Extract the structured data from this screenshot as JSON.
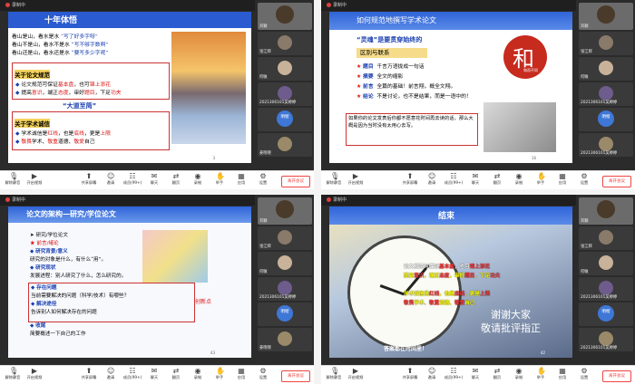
{
  "meeting": {
    "recording": "录制中",
    "leave": "离开会议"
  },
  "toolbar": [
    "解除静音",
    "开启视频",
    "共享屏幕",
    "邀请",
    "成员(99+)",
    "聊天",
    "翻页",
    "录制",
    "举手",
    "应用",
    "设置"
  ],
  "slides": [
    {
      "title": "十年体悟",
      "poem": [
        [
          "看山是山，看水是水",
          "“写了好多字呀”"
        ],
        [
          "看山不是山，看水不是水",
          "“写不够字数啊”"
        ],
        [
          "看山还是山，看水还是水",
          "“要写多少字呢”"
        ]
      ],
      "sec1": "关于论文规范",
      "b1": [
        "论文规范可保证",
        "基本盘",
        "，也可",
        "锦上添花"
      ],
      "b2": [
        "提高",
        "意识",
        "，端正",
        "态度",
        "，审好",
        "题目",
        "，下足",
        "功夫"
      ],
      "motto": "“大道至简”",
      "sec2": "关于学术诚信",
      "b3": [
        "学术诚信是",
        "红线",
        "，也是",
        "底线",
        "，更是",
        "上限"
      ],
      "b4": [
        "敬畏",
        "学术、",
        "敬重",
        "道德、",
        "敬爱",
        "自己"
      ],
      "page": "3"
    },
    {
      "title": "如何规范地撰写学术论文",
      "hero": "“灵魂”是要贯穿始终的",
      "box": "区别与联系",
      "rows": [
        [
          "题目",
          "千言万语拢成一句话"
        ],
        [
          "摘要",
          "全文的缩影"
        ],
        [
          "前言",
          "全篇的基础！前言翔，概全文翔。"
        ],
        [
          "结论",
          "不是讨论，也不是结果，而是一语中的！"
        ]
      ],
      "seal": "和",
      "seal_sub": "和而不同",
      "quote": "如果你的论文发表后你都不愿意花时间再去读的话，那么大概是因为当时没有太用心去写。",
      "page": "16"
    },
    {
      "title": "论文的架构—研究/学位论文",
      "items": [
        [
          "arrow",
          "研究/学位论文"
        ],
        [
          "star",
          "前言/绪论"
        ],
        [
          "dia",
          "研究背景/意义"
        ],
        [
          "txt",
          "研究的对象是什么，有什么“用”。"
        ],
        [
          "dia",
          "研究现状"
        ],
        [
          "txt",
          "发展进程：别人研究了什么，怎么研究的。"
        ]
      ],
      "boxed": [
        [
          "dia",
          "存在问题"
        ],
        [
          "txt",
          "当前需要解决的问题（科学/技术）有哪些？"
        ],
        [
          "dia",
          "解决途径"
        ],
        [
          "txt",
          "告诉别人如何解决存在的问题"
        ]
      ],
      "innov": "创新点",
      "tail": [
        [
          "dia",
          "收尾"
        ],
        [
          "txt",
          "简要概述一下自己的工作"
        ]
      ],
      "page": "43"
    },
    {
      "title": "结束",
      "l1": [
        "论文规范可保证",
        "基本盘",
        "，也可",
        "锦上添花"
      ],
      "l2": [
        "提高",
        "意识",
        "，端正",
        "态度",
        "，审好",
        "题目",
        "，下足",
        "功夫"
      ],
      "l3": [
        "学术诚信是",
        "红线",
        "，也是",
        "底线",
        "，更是",
        "上限"
      ],
      "l4": [
        "敬畏",
        "学术、",
        "敬重",
        "道德、",
        "敬爱",
        "自己"
      ],
      "thanks1": "谢谢大家",
      "thanks2": "敬请批评指正",
      "tip": "答案都在时间里！",
      "page": "42"
    }
  ],
  "strips": [
    [
      "刘颖",
      "张江辉",
      "何敏",
      "2021306101吴婷婷",
      "明楷",
      "姜晓晓"
    ],
    [
      "刘颖",
      "张江辉",
      "何敏",
      "2021306101吴婷婷",
      "明楷",
      "2021306101吴婷婷"
    ],
    [
      "刘颖",
      "张江辉",
      "何敏",
      "2021306101吴婷婷",
      "明楷",
      "姜晓晓"
    ],
    [
      "刘颖",
      "张江辉",
      "何敏",
      "2021306101吴婷婷",
      "明楷",
      "2021306101吴婷婷"
    ]
  ]
}
